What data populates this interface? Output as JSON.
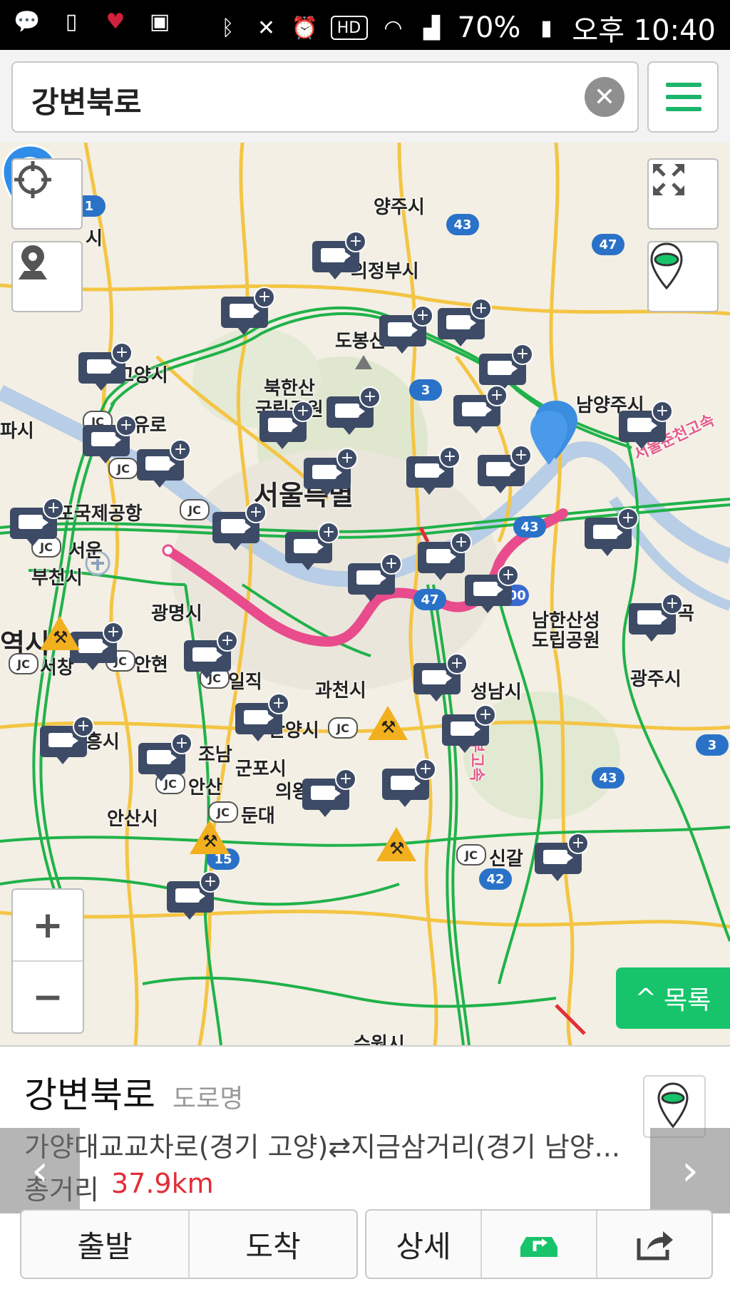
{
  "status_bar": {
    "battery": "70%",
    "time": "오후 10:40",
    "icons": [
      "chat-icon",
      "phone-icon",
      "heart-icon",
      "gallery-icon",
      "bluetooth-icon",
      "mute-icon",
      "alarm-icon",
      "hd-icon",
      "wifi-icon",
      "signal-icon",
      "battery-icon"
    ]
  },
  "search": {
    "value": "강변북로"
  },
  "map": {
    "places": {
      "yangju": "양주시",
      "uijeongbu": "의정부시",
      "dobong": "도봉산",
      "goyang": "고양시",
      "bukhansan": "북한산",
      "national_park": "국립공원",
      "namyangju": "남양주시",
      "seoul": "서울특별",
      "airport": "포국제공항",
      "bucheon": "부천시",
      "gwangmyeong": "광명시",
      "namhansanseong": "남한산성",
      "provincial_park": "도립공원",
      "gwacheon": "과천시",
      "seongnam": "성남시",
      "gwangju": "광주시",
      "anyang": "안양시",
      "siheung": "시흥시",
      "gunpo": "군포시",
      "uiwang": "의왕",
      "ansan": "안산시",
      "suwon": "수원시",
      "si_partial": "시",
      "yeoksi": "역시",
      "pasi": "파시",
      "yuro": "유로",
      "seoun": "서운",
      "seochang": "서창",
      "anhyeon": "안현",
      "iljik": "일직",
      "jonam": "조남",
      "an_san_jc": "안산",
      "dundae": "둔대",
      "singal": "신갈",
      "expressway_seoul_chuncheon": "서울춘천고속",
      "expressway_gyeongbu": "경부고속",
      "gog": "곡"
    },
    "route_numbers": [
      "1",
      "43",
      "47",
      "3",
      "43",
      "47",
      "3",
      "43",
      "15",
      "42",
      "100"
    ],
    "jc_label": "JC"
  },
  "controls": {
    "zoom_in": "+",
    "zoom_out": "−",
    "list_button": "목록",
    "list_chevron": "^"
  },
  "panel": {
    "road_name": "강변북로",
    "road_type": "도로명",
    "description": "가양대교교차로(경기 고양)⇄지금삼거리(경기 남양...",
    "distance_label": "총거리",
    "distance_value": "37.9km",
    "prev_arrow": "‹",
    "next_arrow": "›",
    "buttons": {
      "start": "출발",
      "arrive": "도착",
      "detail": "상세"
    }
  },
  "colors": {
    "accent_green": "#17c46b",
    "route_pink": "#e84c8c",
    "cctv_navy": "#3d4b66",
    "distance_red": "#e22d37"
  }
}
